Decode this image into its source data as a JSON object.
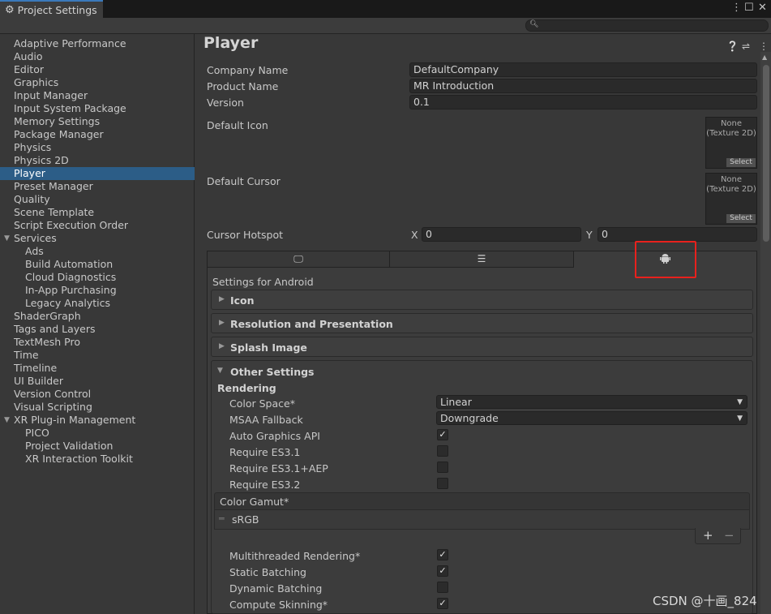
{
  "window": {
    "tab_title": "Project Settings",
    "icons": {
      "tab": "gear-icon",
      "more": "kebab-icon",
      "maximize": "maximize-icon",
      "close": "close-icon"
    }
  },
  "search": {
    "placeholder": "",
    "icon": "search-icon"
  },
  "sidebar": {
    "selected": "Player",
    "items": [
      {
        "label": "Adaptive Performance",
        "level": 0
      },
      {
        "label": "Audio",
        "level": 0
      },
      {
        "label": "Editor",
        "level": 0
      },
      {
        "label": "Graphics",
        "level": 0
      },
      {
        "label": "Input Manager",
        "level": 0
      },
      {
        "label": "Input System Package",
        "level": 0
      },
      {
        "label": "Memory Settings",
        "level": 0
      },
      {
        "label": "Package Manager",
        "level": 0
      },
      {
        "label": "Physics",
        "level": 0
      },
      {
        "label": "Physics 2D",
        "level": 0
      },
      {
        "label": "Player",
        "level": 0
      },
      {
        "label": "Preset Manager",
        "level": 0
      },
      {
        "label": "Quality",
        "level": 0
      },
      {
        "label": "Scene Template",
        "level": 0
      },
      {
        "label": "Script Execution Order",
        "level": 0
      },
      {
        "label": "Services",
        "level": 0,
        "expanded": true
      },
      {
        "label": "Ads",
        "level": 1
      },
      {
        "label": "Build Automation",
        "level": 1
      },
      {
        "label": "Cloud Diagnostics",
        "level": 1
      },
      {
        "label": "In-App Purchasing",
        "level": 1
      },
      {
        "label": "Legacy Analytics",
        "level": 1
      },
      {
        "label": "ShaderGraph",
        "level": 0
      },
      {
        "label": "Tags and Layers",
        "level": 0
      },
      {
        "label": "TextMesh Pro",
        "level": 0
      },
      {
        "label": "Time",
        "level": 0
      },
      {
        "label": "Timeline",
        "level": 0
      },
      {
        "label": "UI Builder",
        "level": 0
      },
      {
        "label": "Version Control",
        "level": 0
      },
      {
        "label": "Visual Scripting",
        "level": 0
      },
      {
        "label": "XR Plug-in Management",
        "level": 0,
        "expanded": true
      },
      {
        "label": "PICO",
        "level": 1
      },
      {
        "label": "Project Validation",
        "level": 1
      },
      {
        "label": "XR Interaction Toolkit",
        "level": 1
      }
    ]
  },
  "player": {
    "title": "Player",
    "header_icons": [
      "help-icon",
      "settings-sliders-icon",
      "kebab-icon"
    ],
    "company_label": "Company Name",
    "company_value": "DefaultCompany",
    "product_label": "Product Name",
    "product_value": "MR Introduction",
    "version_label": "Version",
    "version_value": "0.1",
    "default_icon_label": "Default Icon",
    "default_cursor_label": "Default Cursor",
    "texture_none": "None\n(Texture 2D)",
    "texture_select": "Select",
    "cursor_hotspot_label": "Cursor Hotspot",
    "hotspot_x_label": "X",
    "hotspot_x": "0",
    "hotspot_y_label": "Y",
    "hotspot_y": "0"
  },
  "platform_tabs": [
    {
      "icon": "monitor-icon"
    },
    {
      "icon": "server-rack-icon"
    },
    {
      "icon": "android-icon",
      "active": true,
      "highlighted": true
    }
  ],
  "android": {
    "settings_for": "Settings for Android",
    "sections": [
      "Icon",
      "Resolution and Presentation",
      "Splash Image"
    ],
    "other_settings": "Other Settings",
    "rendering": "Rendering",
    "color_space_label": "Color Space*",
    "color_space_value": "Linear",
    "msaa_label": "MSAA Fallback",
    "msaa_value": "Downgrade",
    "auto_graphics_label": "Auto Graphics API",
    "auto_graphics": true,
    "es31_label": "Require ES3.1",
    "es31": false,
    "es31aep_label": "Require ES3.1+AEP",
    "es31aep": false,
    "es32_label": "Require ES3.2",
    "es32": false,
    "gamut_header": "Color Gamut*",
    "gamut_item": "sRGB",
    "gamut_add": "+",
    "gamut_remove": "−",
    "mt_label": "Multithreaded Rendering*",
    "mt": true,
    "static_label": "Static Batching",
    "static": true,
    "dynamic_label": "Dynamic Batching",
    "dynamic": false,
    "compute_label": "Compute Skinning*",
    "compute": true
  },
  "watermark": "CSDN @十画_824",
  "colors": {
    "background": "#383838",
    "selection": "#2c5d87",
    "highlight_box": "#e8211d",
    "tab_accent": "#3a79bb"
  }
}
